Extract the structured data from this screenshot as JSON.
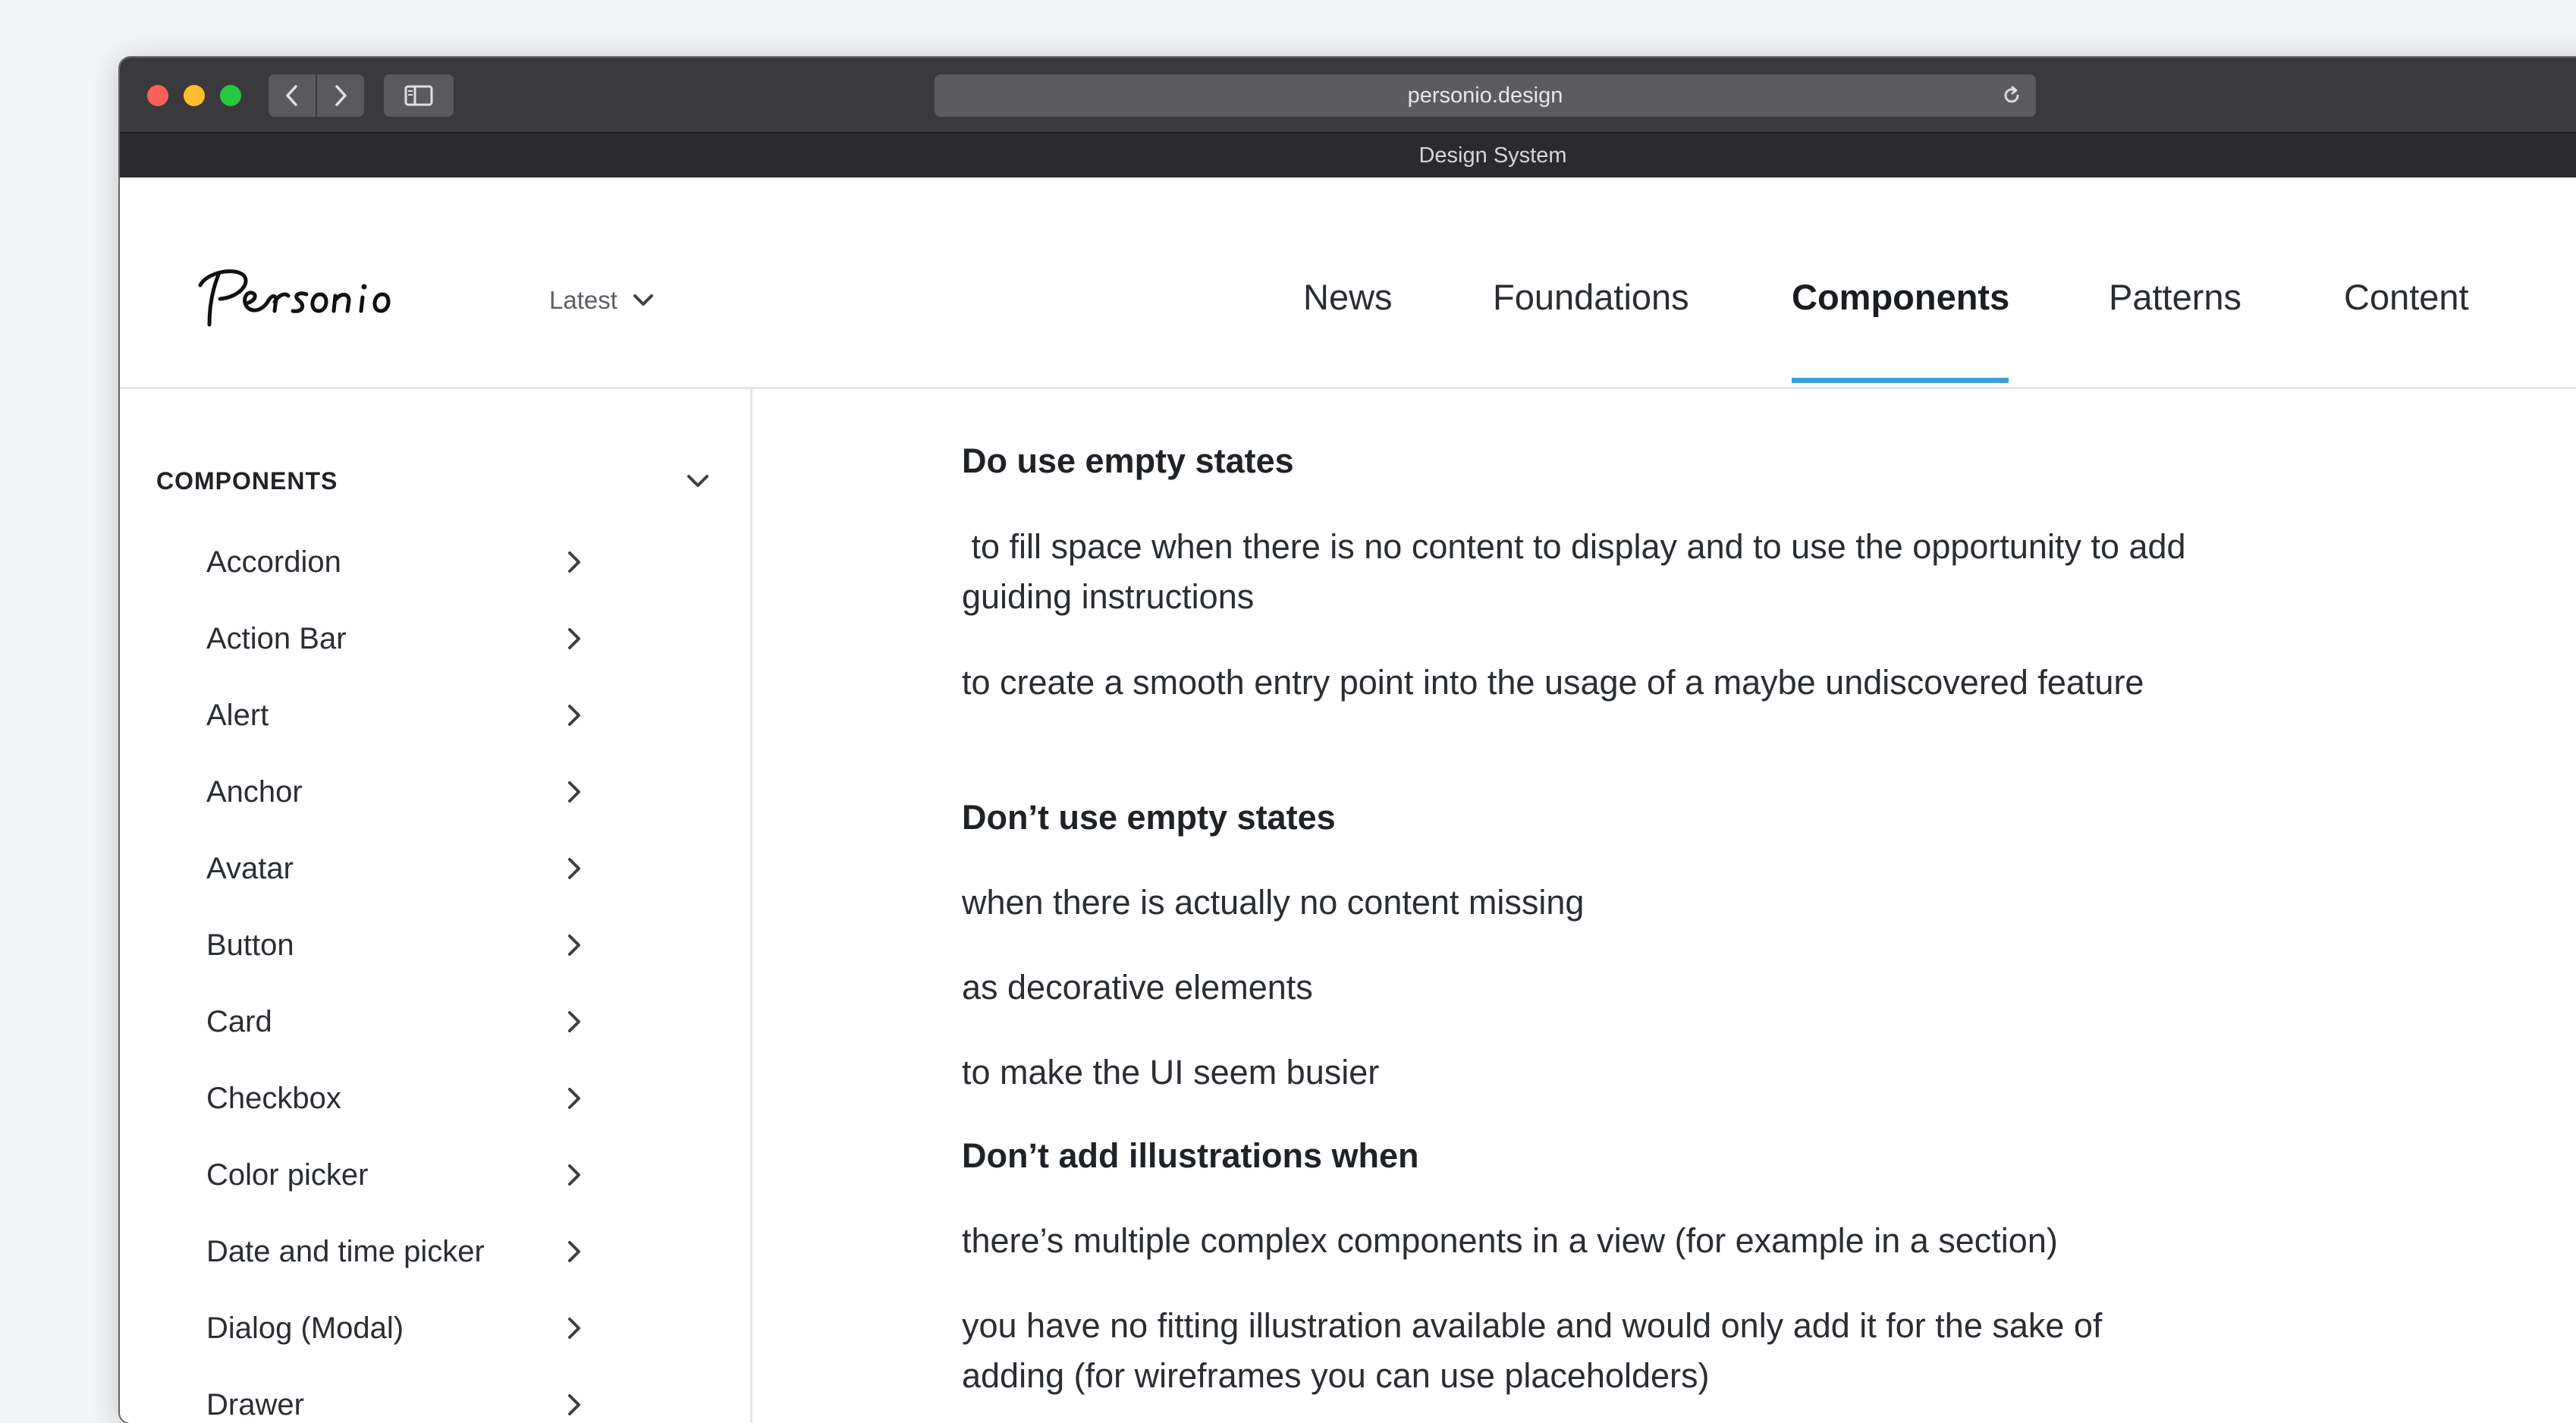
{
  "browser": {
    "url": "personio.design",
    "tab_title": "Design System"
  },
  "header": {
    "logo_alt": "Personio",
    "version_label": "Latest",
    "nav": [
      {
        "label": "News"
      },
      {
        "label": "Foundations"
      },
      {
        "label": "Components"
      },
      {
        "label": "Patterns"
      },
      {
        "label": "Content"
      }
    ],
    "active_nav": "Components",
    "accent_color": "#3aa0dc"
  },
  "sidebar": {
    "section_title": "COMPONENTS",
    "items": [
      {
        "label": "Accordion"
      },
      {
        "label": "Action Bar"
      },
      {
        "label": "Alert"
      },
      {
        "label": "Anchor"
      },
      {
        "label": "Avatar"
      },
      {
        "label": "Button"
      },
      {
        "label": "Card"
      },
      {
        "label": "Checkbox"
      },
      {
        "label": "Color picker"
      },
      {
        "label": "Date and time picker"
      },
      {
        "label": "Dialog (Modal)"
      },
      {
        "label": "Drawer"
      }
    ]
  },
  "content": {
    "do_heading": "Do use empty states",
    "do_items": [
      " to fill space when there is no content to display and to use the opportunity to add guiding instructions",
      "to create a smooth entry point into the usage of a maybe undiscovered feature"
    ],
    "dont_heading": "Don’t use empty states",
    "dont_items": [
      "when there is actually no content missing",
      "as decorative elements",
      "to make the UI seem busier"
    ],
    "dont_illus_heading": "Don’t add illustrations when",
    "dont_illus_items": [
      "there’s multiple complex components in a view (for example in a section)",
      "you have no fitting illustration available and would only add it for the sake of adding (for wireframes you can use placeholders)"
    ]
  }
}
